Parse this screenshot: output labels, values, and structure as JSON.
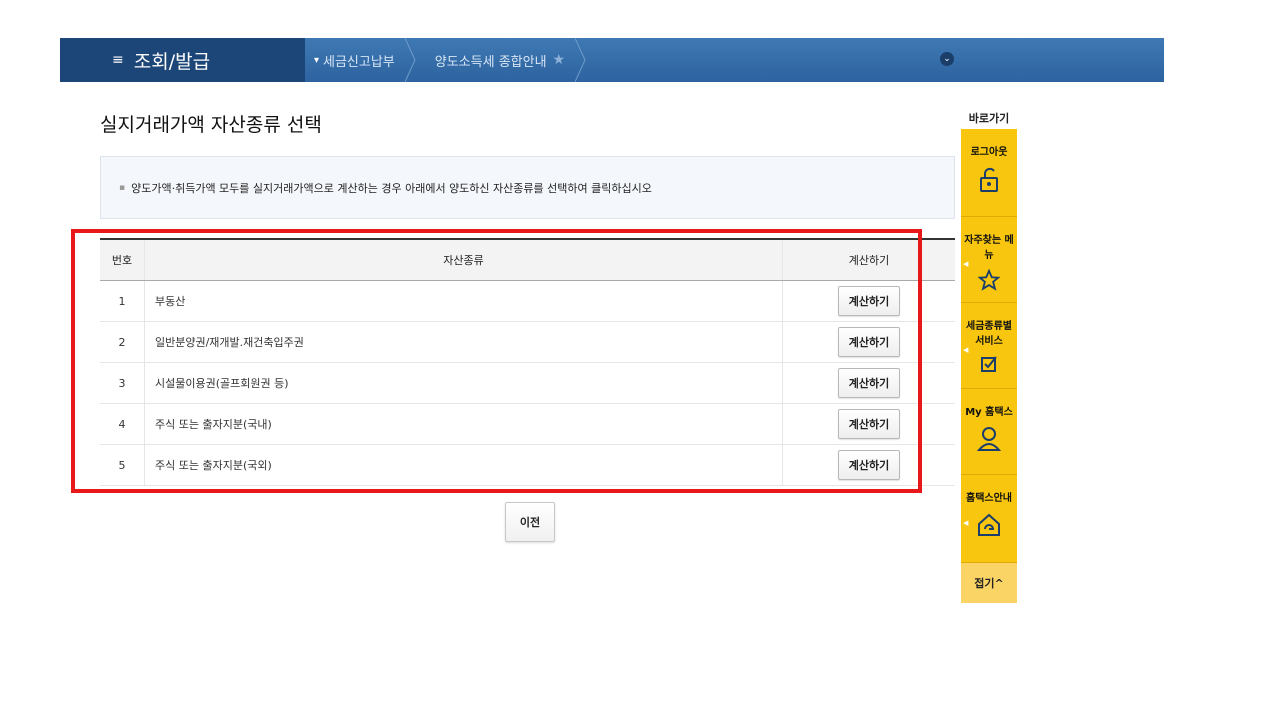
{
  "nav": {
    "menu_icon": "≡",
    "menu_title": "조회/발급",
    "menu_caret": "▾",
    "crumbs": [
      "세금신고납부",
      "양도소득세 종합안내"
    ],
    "star": "★",
    "circle": "⌄"
  },
  "page_title": "실지거래가액 자산종류 선택",
  "notice": "양도가액·취득가액 모두를 실지거래가액으로 계산하는 경우 아래에서 양도하신 자산종류를 선택하여 클릭하십시오",
  "table": {
    "headers": [
      "번호",
      "자산종류",
      "계산하기"
    ],
    "rows": [
      {
        "num": "1",
        "name": "부동산",
        "action": "계산하기"
      },
      {
        "num": "2",
        "name": "일반분양권/재개발.재건축입주권",
        "action": "계산하기"
      },
      {
        "num": "3",
        "name": "시설물이용권(골프회원권 등)",
        "action": "계산하기"
      },
      {
        "num": "4",
        "name": "주식 또는 출자지분(국내)",
        "action": "계산하기"
      },
      {
        "num": "5",
        "name": "주식 또는 출자지분(국외)",
        "action": "계산하기"
      }
    ]
  },
  "prev_button": "이전",
  "quick": {
    "title": "바로가기",
    "items": [
      "로그아웃",
      "자주찾는 메뉴",
      "세금종류별 서비스",
      "My 홈택스",
      "홈택스안내"
    ],
    "fold": "접기^"
  },
  "colors": {
    "nav": "#2d63a0",
    "nav_dark": "#1d4678",
    "quick": "#f8c60f",
    "highlight": "#e8171a"
  }
}
